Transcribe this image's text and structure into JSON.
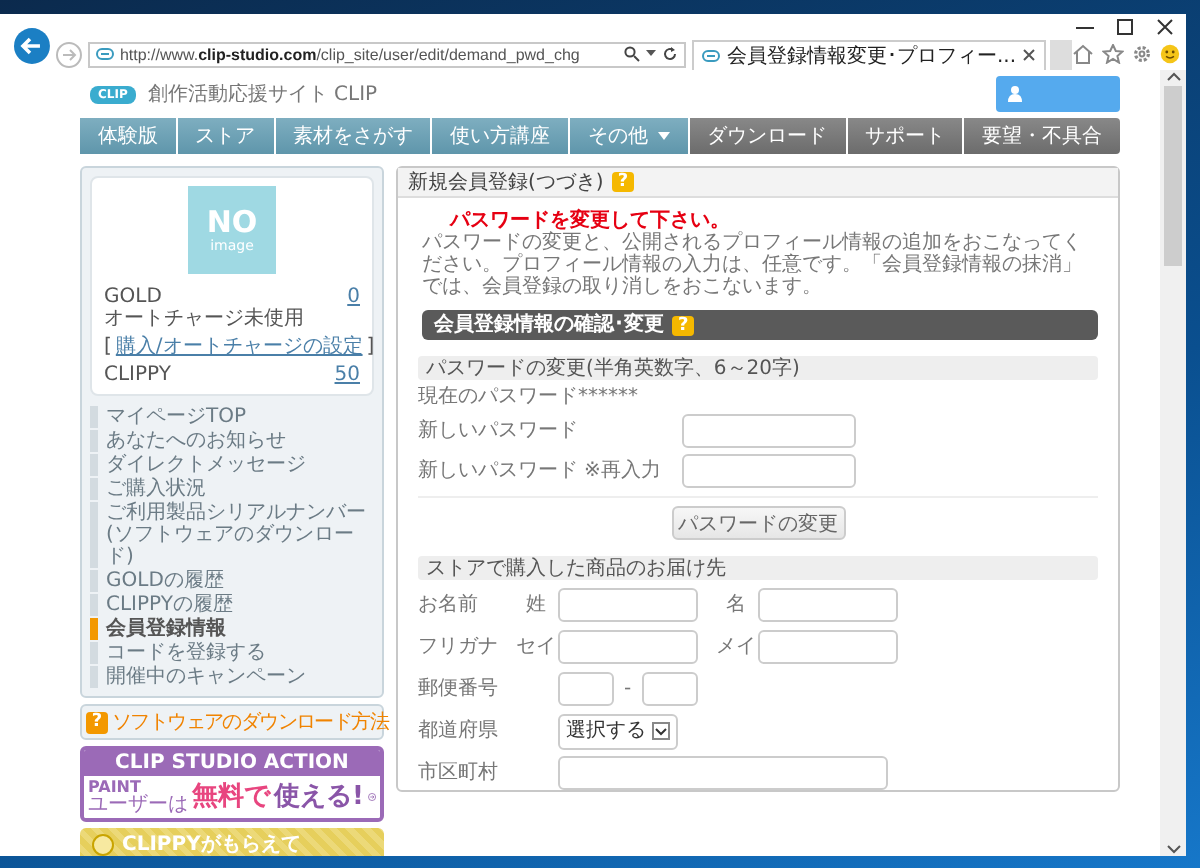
{
  "browser": {
    "url": "http://www.**clip-studio.com**/clip_site/user/edit/demand_pwd_chg",
    "tabs": [
      {
        "label": "会員登録情報変更･プロフィー...",
        "selected": true
      }
    ]
  },
  "site": {
    "logo": "CLIP",
    "title": "創作活動応援サイト CLIP"
  },
  "nav": [
    {
      "label": "体験版",
      "kind": "primary",
      "has_menu": false
    },
    {
      "label": "ストア",
      "kind": "primary",
      "has_menu": false
    },
    {
      "label": "素材をさがす",
      "kind": "primary",
      "has_menu": false
    },
    {
      "label": "使い方講座",
      "kind": "primary",
      "has_menu": false
    },
    {
      "label": "その他",
      "kind": "primary",
      "has_menu": true
    },
    {
      "label": "ダウンロード",
      "kind": "secondary",
      "has_menu": false
    },
    {
      "label": "サポート",
      "kind": "secondary",
      "has_menu": false
    },
    {
      "label": "要望・不具合",
      "kind": "secondary",
      "has_menu": false
    }
  ],
  "profile": {
    "image": [
      "NO",
      "image"
    ],
    "plan": "GOLD",
    "plan_value": "0",
    "charge_status": "オートチャージ未使用",
    "link_brackets": [
      "[",
      "]"
    ],
    "settings_link": "購入/オートチャージの設定",
    "points_label": "CLIPPY",
    "points": "50"
  },
  "menu": [
    {
      "label": "マイページTOP",
      "selected": false
    },
    {
      "label": "あなたへのお知らせ",
      "selected": false
    },
    {
      "label": "ダイレクトメッセージ",
      "selected": false
    },
    {
      "label": "ご購入状況",
      "selected": false
    },
    {
      "label": "ご利用製品シリアルナンバー(ソフトウェアのダウンロード)",
      "selected": false
    },
    {
      "label": "GOLDの履歴",
      "selected": false
    },
    {
      "label": "CLIPPYの履歴",
      "selected": false
    },
    {
      "label": "会員登録情報",
      "selected": true
    },
    {
      "label": "コードを登録する",
      "selected": false
    },
    {
      "label": "開催中のキャンペーン",
      "selected": false
    }
  ],
  "download_help": {
    "badge": "?",
    "label": "ソフトウェアのダウンロード方法"
  },
  "promo": {
    "title": "CLIP STUDIO ACTION",
    "product": "PAINT",
    "audience": "ユーザーは",
    "highlight": "無料で",
    "rest": "使える!"
  },
  "clippy_banner": {
    "label": "CLIPPYがもらえて"
  },
  "main": {
    "title": "新規会員登録(つづき)",
    "title_badge": "?",
    "warning": "パスワードを変更して下さい。",
    "intro": "パスワードの変更と、公開されるプロフィール情報の追加をおこなってください。プロフィール情報の入力は、任意です。「会員登録情報の抹消」では、会員登録の取り消しをおこないます。",
    "section_title": "会員登録情報の確認･変更",
    "section_badge": "?",
    "password": {
      "heading": "パスワードの変更(半角英数字、6～20字)",
      "current_label": "現在のパスワード",
      "current_value": "******",
      "fields": [
        {
          "label": "新しいパスワード"
        },
        {
          "label": "新しいパスワード",
          "note": "※再入力"
        }
      ],
      "button": "パスワードの変更"
    },
    "address": {
      "heading": "ストアで購入した商品のお届け先",
      "rows": [
        {
          "kind": "pair",
          "label": "お名前",
          "parts": [
            "姓",
            "名"
          ]
        },
        {
          "kind": "pair",
          "label": "フリガナ",
          "parts": [
            "セイ",
            "メイ"
          ]
        },
        {
          "kind": "postal",
          "label": "郵便番号",
          "separator": "-"
        },
        {
          "kind": "select",
          "label": "都道府県",
          "value": "選択する"
        },
        {
          "kind": "text",
          "label": "市区町村"
        }
      ]
    }
  }
}
